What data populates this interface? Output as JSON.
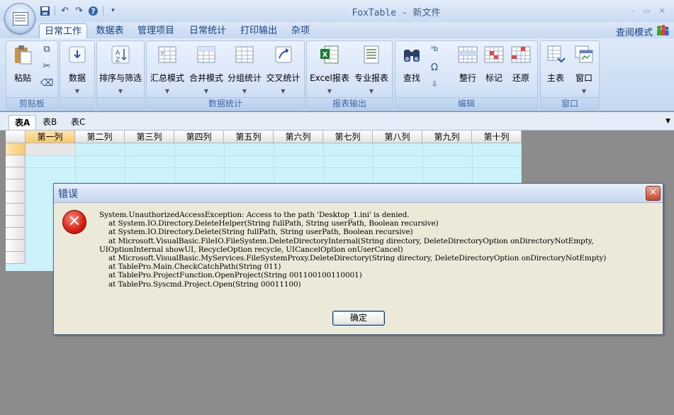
{
  "window": {
    "title": "FoxTable - 新文件",
    "controls": [
      "–",
      "▭",
      "✕"
    ]
  },
  "ribbon": {
    "tabs": [
      "日常工作",
      "数据表",
      "管理项目",
      "日常统计",
      "打印输出",
      "杂项"
    ],
    "view_mode": "查阅模式",
    "groups": {
      "clipboard": {
        "label": "剪贴板",
        "paste": "粘贴"
      },
      "data": {
        "button": "数据"
      },
      "sort": {
        "button": "排序与筛选"
      },
      "stats": {
        "label": "数据统计",
        "buttons": [
          "汇总模式",
          "合并模式",
          "分组统计",
          "交叉统计"
        ]
      },
      "report": {
        "label": "报表输出",
        "buttons": [
          "Excel报表",
          "专业报表"
        ]
      },
      "edit": {
        "label": "编辑",
        "buttons": [
          "查找",
          "整行",
          "标记",
          "还原"
        ]
      },
      "window": {
        "label": "窗口",
        "buttons": [
          "主表",
          "窗口"
        ]
      }
    }
  },
  "sheet_tabs": [
    "表A",
    "表B",
    "表C"
  ],
  "grid": {
    "columns": [
      "第一列",
      "第二列",
      "第三列",
      "第四列",
      "第五列",
      "第六列",
      "第七列",
      "第八列",
      "第九列",
      "第十列"
    ]
  },
  "dialog": {
    "title": "错误",
    "message": "System.UnauthorizedAccessException: Access to the path 'Desktop_1.ini' is denied.\n    at System.IO.Directory.DeleteHelper(String fullPath, String userPath, Boolean recursive)\n    at System.IO.Directory.Delete(String fullPath, String userPath, Boolean recursive)\n    at Microsoft.VisualBasic.FileIO.FileSystem.DeleteDirectoryInternal(String directory, DeleteDirectoryOption onDirectoryNotEmpty,\nUIOptionInternal showUI, RecycleOption recycle, UICancelOption onUserCancel)\n    at Microsoft.VisualBasic.MyServices.FileSystemProxy.DeleteDirectory(String directory, DeleteDirectoryOption onDirectoryNotEmpty)\n    at TablePro.Main.CheckCatchPath(String 011)\n    at TablePro.ProjectFunction.OpenProject(String 001100100110001)\n    at TablePro.Syscmd.Project.Open(String 00011100)",
    "ok_label": "确定"
  }
}
